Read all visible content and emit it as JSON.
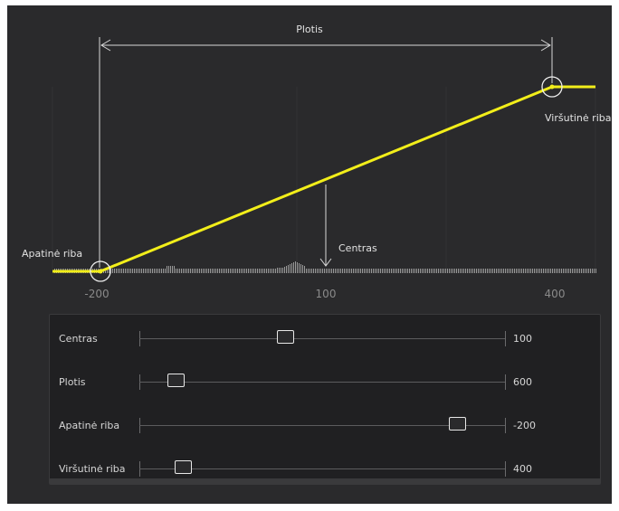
{
  "graph": {
    "width_label": "Plotis",
    "center_label": "Centras",
    "lower_label": "Apatinė riba",
    "upper_label": "Viršutinė riba",
    "x_ticks": [
      "-200",
      "100",
      "400"
    ],
    "curve_color": "#f2ee1a"
  },
  "controls": {
    "sliders": [
      {
        "label": "Centras",
        "value": "100",
        "position": 0.4
      },
      {
        "label": "Plotis",
        "value": "600",
        "position": 0.1
      },
      {
        "label": "Apatinė riba",
        "value": "-200",
        "position": 0.87
      },
      {
        "label": "Viršutinė riba",
        "value": "400",
        "position": 0.12
      }
    ]
  }
}
